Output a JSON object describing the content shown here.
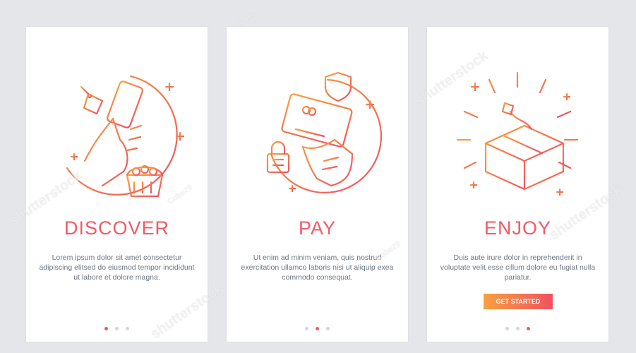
{
  "screens": [
    {
      "title": "DISCOVER",
      "description": "Lorem ipsum dolor sit amet consectetur adipiscing elitsed do eiusmod tempor incididunt ut labore et dolore magna.",
      "illustration": "hand-phone-basket-icon",
      "active_dot": 1
    },
    {
      "title": "PAY",
      "description": "Ut enim ad minim veniam, quis nostrud exercitation ullamco laboris nisi ut aliquip exea commodo consequat.",
      "illustration": "hand-card-shield-icon",
      "active_dot": 2
    },
    {
      "title": "ENJOY",
      "description": "Duis aute irure dolor in reprehenderit in voluptate velit esse cillum dolore eu fugiat nulla pariatur.",
      "illustration": "open-box-icon",
      "button_label": "GET STARTED",
      "active_dot": 3
    }
  ],
  "watermark": {
    "text": "shutterstock",
    "tag": "Cube29"
  },
  "colors": {
    "accent_red": "#f05a66",
    "accent_orange": "#f9a040",
    "background": "#e4e6ea",
    "text": "#6d7784"
  }
}
